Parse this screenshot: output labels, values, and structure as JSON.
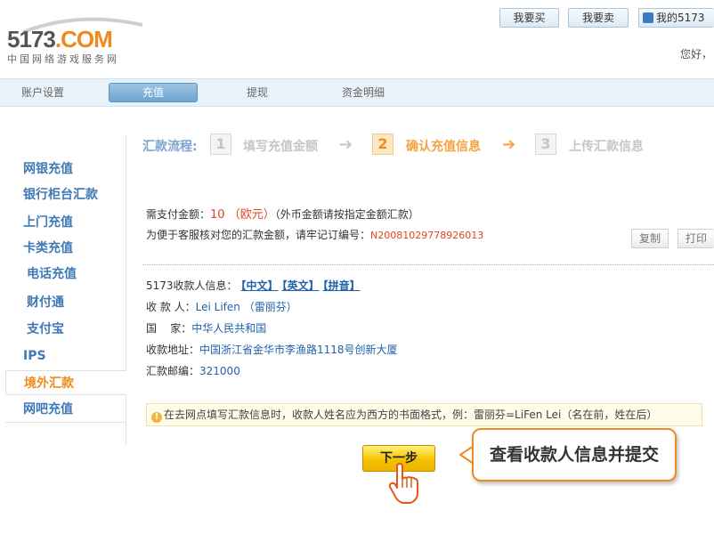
{
  "header": {
    "logo_text_left": "5173",
    "logo_text_right": ".COM",
    "logo_subtitle": "中国网络游戏服务网",
    "buy_button": "我要买",
    "sell_button": "我要卖",
    "my_button": "我的5173",
    "greeting": "您好，"
  },
  "nav": {
    "items": [
      "账户设置",
      "充值",
      "提现",
      "资金明细"
    ],
    "active": "充值"
  },
  "sidebar": {
    "items": [
      "网银充值",
      "银行柜台汇款",
      "上门充值",
      "卡类充值",
      "电话充值",
      "财付通",
      "支付宝",
      "IPS",
      "境外汇款",
      "网吧充值"
    ],
    "active": "境外汇款"
  },
  "steps": {
    "label": "汇款流程:",
    "step1_num": "1",
    "step1_text": "填写充值金额",
    "step2_num": "2",
    "step2_text": "确认充值信息",
    "step3_num": "3",
    "step3_text": "上传汇款信息",
    "arrow": "➔",
    "current_step": 2
  },
  "payment": {
    "amount_label": "需支付金额：",
    "amount_value": "10 （欧元）",
    "amount_note": "（外币金额请按指定金额汇款）",
    "ref_label": "为便于客服核对您的汇款金额，请牢记订编号：",
    "ref_value": "N20081029778926013",
    "copy_button": "复制",
    "print_button": "打印"
  },
  "recipient": {
    "title_label": "5173收款人信息：",
    "lang_links": [
      "【中文】",
      "【英文】",
      "【拼音】"
    ],
    "payee_label": "收 款 人：",
    "payee_value": "Lei Lifen （雷丽芬）",
    "country_label": "国    家：",
    "country_value": "中华人民共和国",
    "address_label": "收款地址：",
    "address_value": "中国浙江省金华市李渔路1118号创新大厦",
    "postcode_label": "汇款邮编：",
    "postcode_value": "321000"
  },
  "tip": {
    "icon": "!",
    "text": "在去网点填写汇款信息时，收款人姓名应为西方的书面格式，例：雷丽芬=LiFen Lei（名在前，姓在后）"
  },
  "next_button": "下一步",
  "callout": "查看收款人信息并提交",
  "colors": {
    "accent_orange": "#f08a1c",
    "link_blue": "#1f62a8",
    "sidebar_blue": "#3e79b6",
    "amount_red": "#e2451d"
  }
}
